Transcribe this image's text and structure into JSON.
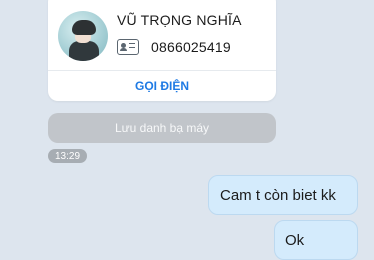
{
  "contact_card": {
    "name": "VŨ TRỌNG NGHĨA",
    "phone": "0866025419",
    "call_label": "GỌI ĐIỆN"
  },
  "save_contact_label": "Lưu danh bạ máy",
  "time_badge": "13:29",
  "messages": [
    {
      "text": "Cam t còn biet kk",
      "direction": "outgoing"
    },
    {
      "text": "Ok",
      "direction": "outgoing"
    }
  ],
  "colors": {
    "background": "#dde5ee",
    "accent": "#1e7ae4",
    "outgoing_bubble": "#d4ebfc"
  },
  "icons": {
    "id_card": "id-card-icon"
  }
}
